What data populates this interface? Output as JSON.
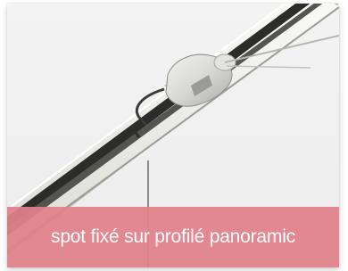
{
  "caption": {
    "text": "spot fixé sur profilé panoramic",
    "band_color": "#e0808a",
    "text_color": "#ffffff"
  },
  "photo": {
    "subject": "rail-spot-fixture",
    "background_color": "#f1f1f1"
  }
}
